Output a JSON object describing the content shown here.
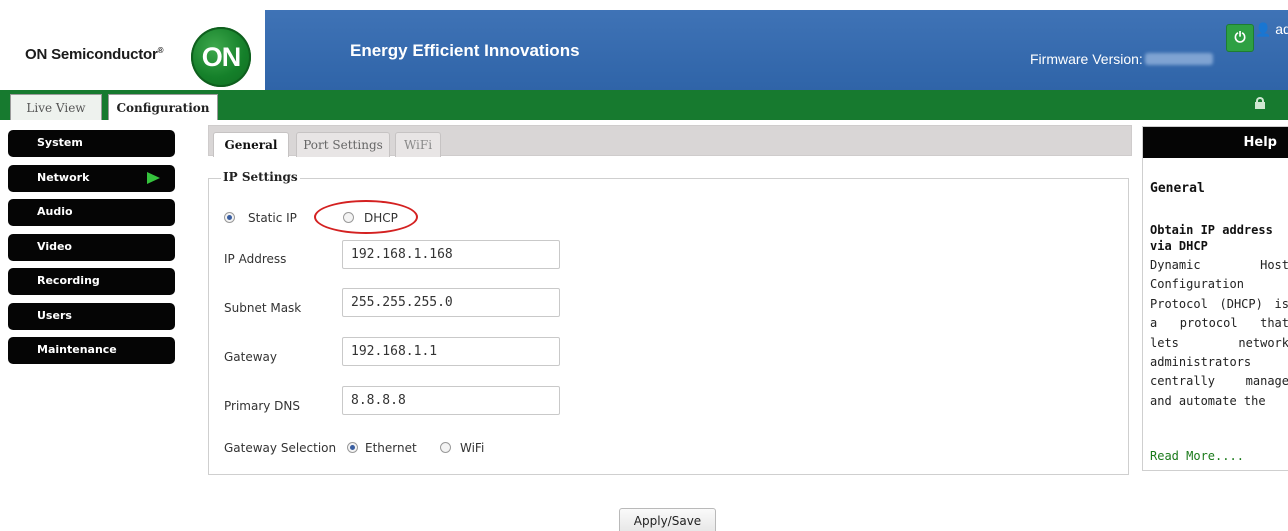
{
  "header": {
    "brand": "ON Semiconductor",
    "brand_mark": "®",
    "logo_text": "ON",
    "tagline": "Energy Efficient Innovations",
    "username": "admin",
    "firmware_label": "Firmware Version:",
    "power_icon": "power-icon",
    "colors": {
      "blue": "#3468ac",
      "green": "#177a2f"
    }
  },
  "top_tabs": {
    "live_view": "Live View",
    "configuration": "Configuration"
  },
  "sidebar": {
    "items": [
      {
        "label": "System"
      },
      {
        "label": "Network",
        "active": true
      },
      {
        "label": "Audio"
      },
      {
        "label": "Video"
      },
      {
        "label": "Recording"
      },
      {
        "label": "Users"
      },
      {
        "label": "Maintenance"
      }
    ]
  },
  "content_tabs": {
    "general": "General",
    "port_settings": "Port Settings",
    "wifi": "WiFi"
  },
  "ip_settings": {
    "legend": "IP Settings",
    "static_ip_label": "Static IP",
    "dhcp_label": "DHCP",
    "mode": "Static IP",
    "ip_address_label": "IP Address",
    "ip_address": "192.168.1.168",
    "subnet_mask_label": "Subnet Mask",
    "subnet_mask": "255.255.255.0",
    "gateway_label": "Gateway",
    "gateway": "192.168.1.1",
    "primary_dns_label": "Primary DNS",
    "primary_dns": "8.8.8.8",
    "gateway_selection_label": "Gateway Selection",
    "ethernet_label": "Ethernet",
    "wifi_label": "WiFi",
    "gateway_selected": "Ethernet"
  },
  "apply_button": "Apply/Save",
  "help": {
    "header": "Help",
    "title": "General",
    "subtitle": "Obtain IP address via DHCP",
    "body": "Dynamic Host Configuration Protocol (DHCP) is a protocol that lets network administrators centrally manage and automate the",
    "read_more": "Read More...."
  }
}
